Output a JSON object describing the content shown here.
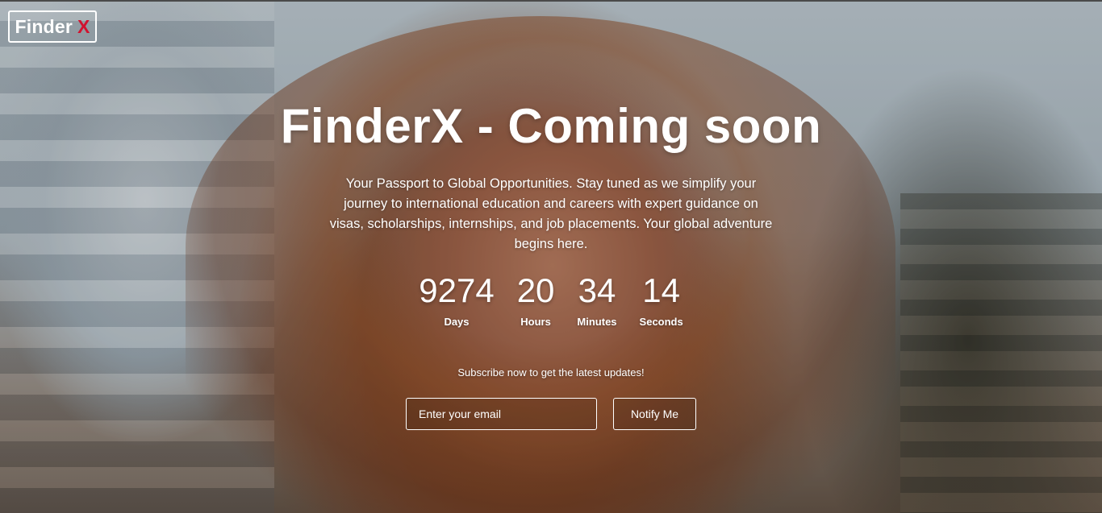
{
  "logo": {
    "text": "Finder",
    "accent": "X",
    "accent_color": "#d1122f"
  },
  "hero": {
    "title": "FinderX - Coming soon",
    "description": "Your Passport to Global Opportunities. Stay tuned as we simplify your journey to international education and careers with expert guidance on visas, scholarships, internships, and job placements. Your global adventure begins here."
  },
  "countdown": [
    {
      "value": "9274",
      "label": "Days"
    },
    {
      "value": "20",
      "label": "Hours"
    },
    {
      "value": "34",
      "label": "Minutes"
    },
    {
      "value": "14",
      "label": "Seconds"
    }
  ],
  "subscribe": {
    "text": "Subscribe now to get the latest updates!",
    "email_placeholder": "Enter your email",
    "button_label": "Notify Me"
  }
}
